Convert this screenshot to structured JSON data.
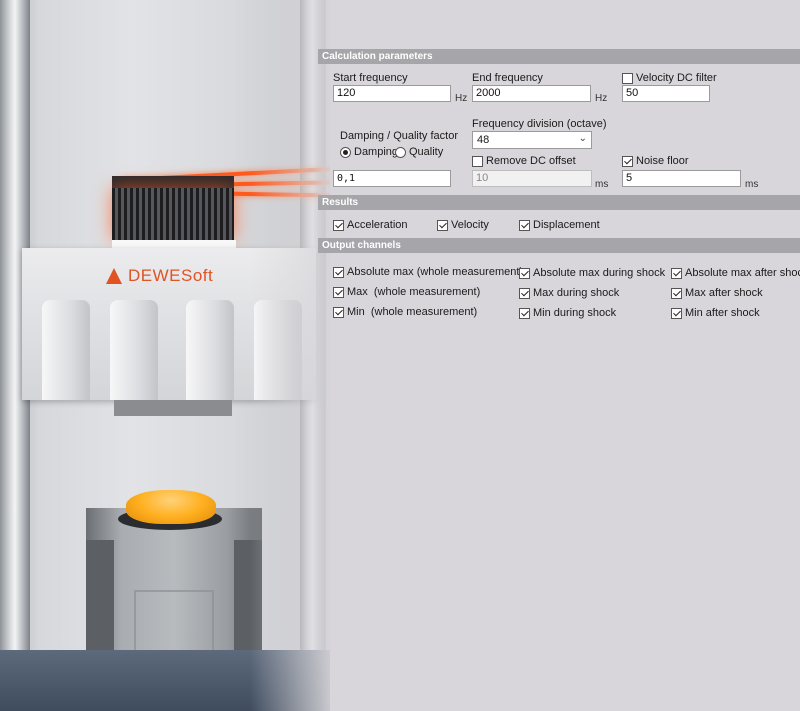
{
  "photo": {
    "logo_text": "DEWESoft"
  },
  "sections": {
    "calc": "Calculation parameters",
    "results": "Results",
    "output": "Output channels"
  },
  "calc": {
    "start_frequency": {
      "label": "Start frequency",
      "value": "120",
      "unit": "Hz"
    },
    "end_frequency": {
      "label": "End frequency",
      "value": "2000",
      "unit": "Hz"
    },
    "velocity_dc_filter": {
      "label": "Velocity DC filter",
      "checked": false,
      "value": "50"
    },
    "damping_quality": {
      "label": "Damping / Quality factor",
      "options": [
        "Damping",
        "Quality"
      ],
      "selected": "Damping",
      "value": "0,1"
    },
    "frequency_division": {
      "label": "Frequency division (octave)",
      "selected": "48"
    },
    "remove_dc_offset": {
      "label": "Remove DC offset",
      "checked": false,
      "value": "10",
      "unit": "ms"
    },
    "noise_floor": {
      "label": "Noise floor",
      "checked": true,
      "value": "5",
      "unit": "ms"
    }
  },
  "results": [
    {
      "label": "Acceleration",
      "checked": true
    },
    {
      "label": "Velocity",
      "checked": true
    },
    {
      "label": "Displacement",
      "checked": true
    }
  ],
  "output": {
    "col1": [
      {
        "label": "Absolute max (whole measurement)",
        "checked": true
      },
      {
        "label": "Max  (whole measurement)",
        "checked": true
      },
      {
        "label": "Min  (whole measurement)",
        "checked": true
      }
    ],
    "col2": [
      {
        "label": "Absolute max during shock",
        "checked": true
      },
      {
        "label": "Max during shock",
        "checked": true
      },
      {
        "label": "Min during shock",
        "checked": true
      }
    ],
    "col3": [
      {
        "label": "Absolute max after shock",
        "checked": true
      },
      {
        "label": "Max after shock",
        "checked": true
      },
      {
        "label": "Min after shock",
        "checked": true
      }
    ]
  }
}
